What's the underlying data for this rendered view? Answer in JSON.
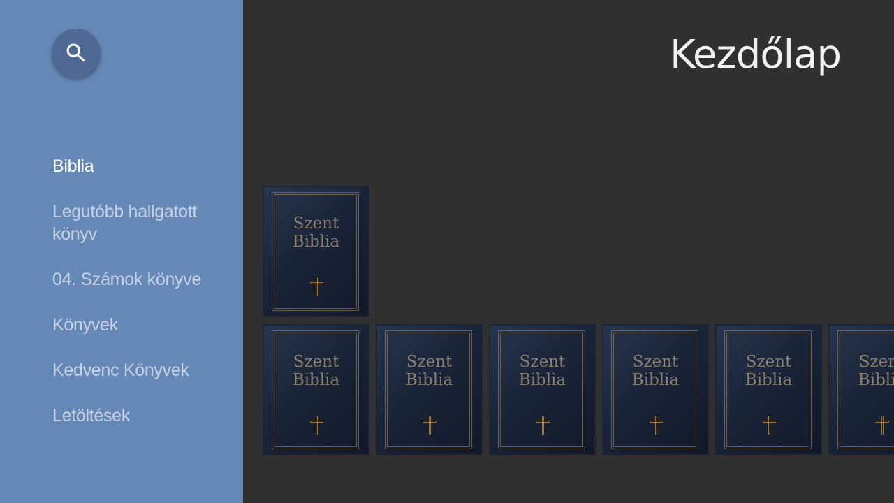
{
  "header": {
    "title": "Kezdőlap"
  },
  "search": {
    "icon": "search-icon"
  },
  "sidebar": {
    "items": [
      {
        "label": "Biblia",
        "active": true
      },
      {
        "label": "Legutóbb hallgatott könyv",
        "active": false
      },
      {
        "label": "04. Számok könyve",
        "active": false
      },
      {
        "label": "Könyvek",
        "active": false
      },
      {
        "label": "Kedvenc Könyvek",
        "active": false
      },
      {
        "label": "Letöltések",
        "active": false
      }
    ]
  },
  "rows": [
    {
      "cards": [
        {
          "title_line1": "Szent",
          "title_line2": "Biblia"
        }
      ]
    },
    {
      "cards": [
        {
          "title_line1": "Szent",
          "title_line2": "Biblia"
        },
        {
          "title_line1": "Szent",
          "title_line2": "Biblia"
        },
        {
          "title_line1": "Szent",
          "title_line2": "Biblia"
        },
        {
          "title_line1": "Szent",
          "title_line2": "Biblia"
        },
        {
          "title_line1": "Szent",
          "title_line2": "Biblia"
        },
        {
          "title_line1": "Szent",
          "title_line2": "Biblia"
        }
      ]
    }
  ],
  "colors": {
    "sidebar_bg": "#6688b7",
    "search_bg": "#4f6894",
    "main_bg": "#303030",
    "cover_text": "#8a7f6e",
    "cover_gold": "#b08e58"
  }
}
